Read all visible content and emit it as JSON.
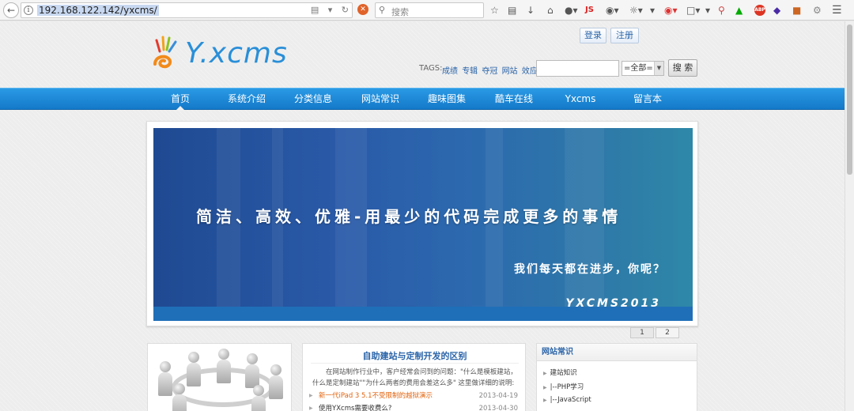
{
  "browser": {
    "url": "192.168.122.142/yxcms/",
    "search_placeholder": "搜索",
    "toolbar_icons": [
      "star-icon",
      "reader-icon",
      "download-icon",
      "home-icon",
      "globe-icon",
      "js-icon",
      "color-icon",
      "eye-icon",
      "flag-icon",
      "bookmark-icon",
      "zoom-icon",
      "shield-icon",
      "adblock-icon",
      "diamond-icon",
      "n-icon",
      "settings-icon",
      "menu-icon"
    ],
    "toolbar_js_label": "JS",
    "toolbar_abp_label": "ABP"
  },
  "header": {
    "logo_text": "Y.xcms",
    "login_label": "登录",
    "register_label": "注册",
    "tags_label": "TAGS:",
    "tags": [
      "成绩",
      "专辑",
      "夺冠",
      "网站",
      "效应 ..."
    ],
    "scope_value": "=全部=",
    "search_button": "搜 索"
  },
  "nav": {
    "items": [
      "首页",
      "系统介绍",
      "分类信息",
      "网站常识",
      "趣味图集",
      "酷车在线",
      "Yxcms",
      "留言本"
    ],
    "active_index": 0
  },
  "banner": {
    "title": "简洁、高效、优雅-用最少的代码完成更多的事情",
    "subtitle": "我们每天都在进步，你呢？",
    "brand": "YXCMS2013",
    "pages": [
      "1",
      "2"
    ],
    "current_page": 1
  },
  "article": {
    "title": "自助建站与定制开发的区别",
    "summary": "在网站制作行业中，客户经常会问到的问题：\"什么是模板建站，什么是定制建站\"\"为什么两者的费用会差这么多\" 这里做详细的说明:",
    "news": [
      {
        "title": "新一代iPad 3 5.1不受限制的越狱演示",
        "date": "2013-04-19"
      },
      {
        "title": "使用YXcms需要收费么?",
        "date": "2013-04-30"
      }
    ]
  },
  "sidebar": {
    "heading": "网站常识",
    "items": [
      "建站知识",
      "|--PHP学习",
      "|--JavaScript"
    ]
  },
  "colors": {
    "nav_blue": "#1a85d4",
    "link_blue": "#2a64a8",
    "highlight_orange": "#e2640f"
  }
}
